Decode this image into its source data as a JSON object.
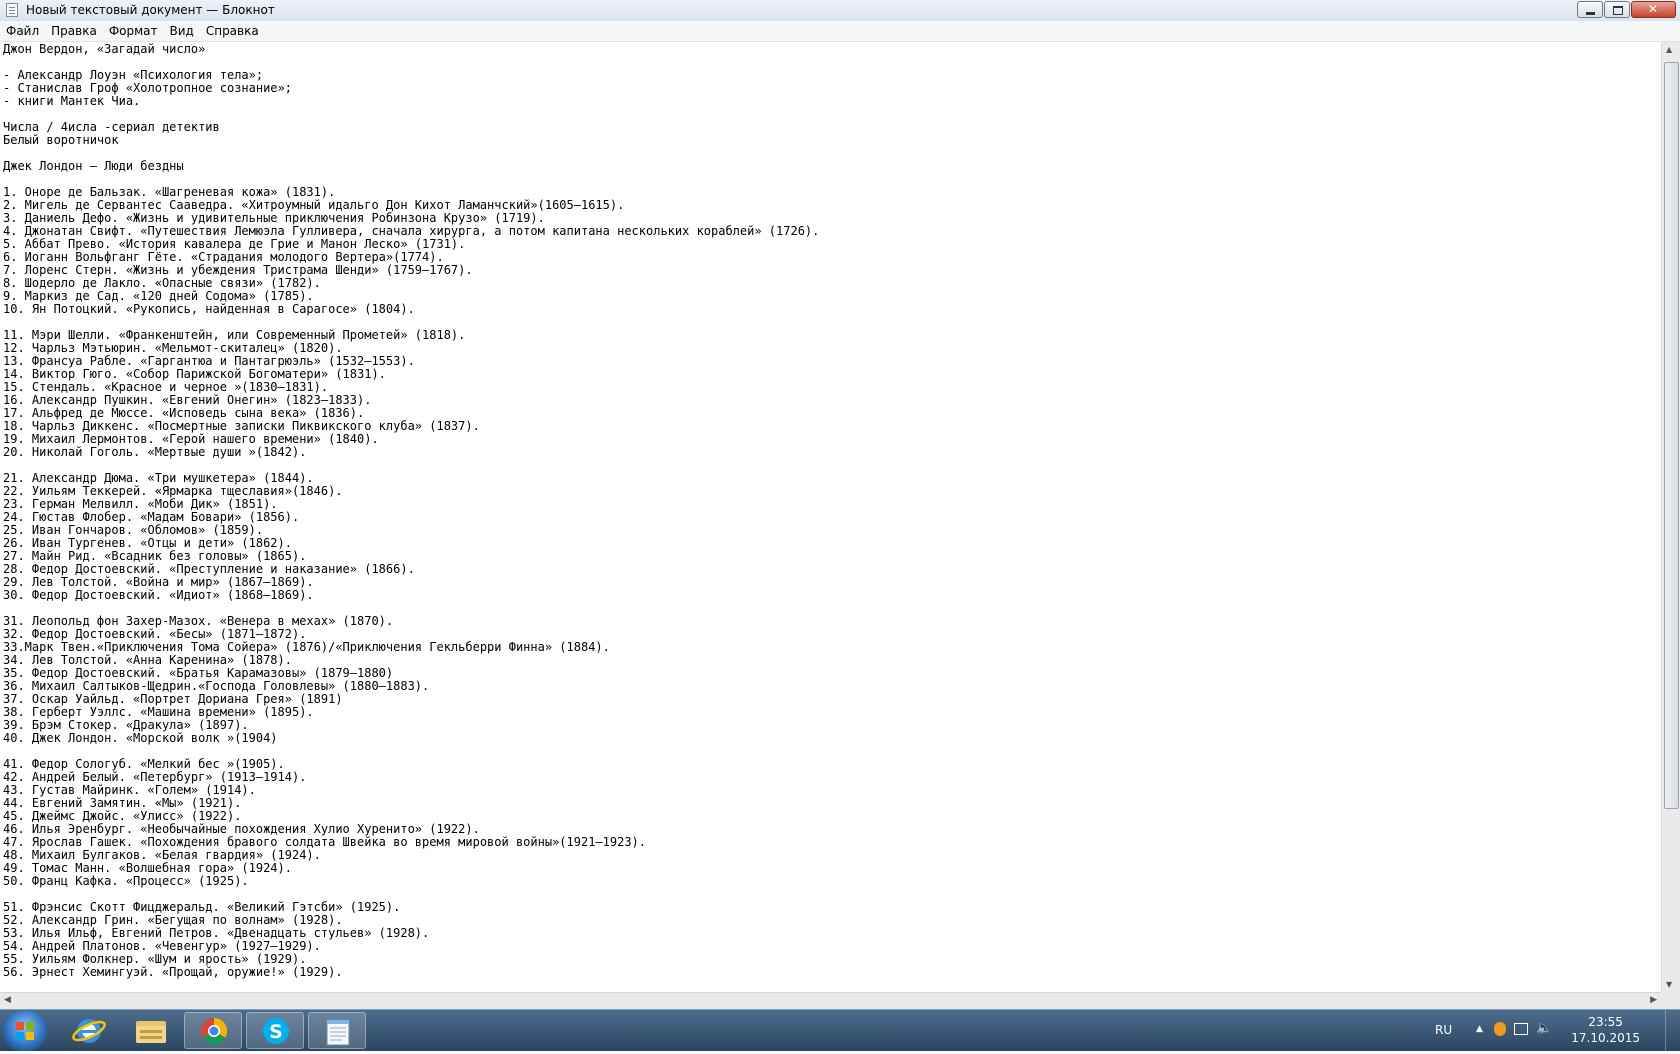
{
  "window": {
    "title": "Новый текстовый документ — Блокнот"
  },
  "menu": [
    "Файл",
    "Правка",
    "Формат",
    "Вид",
    "Справка"
  ],
  "document": {
    "text": "Джон Вердон, «Загадай число»\n\n- Александр Лоуэн «Психология тела»;\n- Станислав Гроф «Холотропное сознание»;\n- книги Мантек Чиа.\n\nЧисла / 4исла -сериал детектив\nБелый воротничок\n\nДжек Лондон – Люди бездны\n\n1. Оноре де Бальзак. «Шагреневая кожа» (1831).\n2. Мигель де Сервантес Сааведра. «Хитроумный идальго Дон Кихот Ламанчский»(1605–1615).\n3. Даниель Дефо. «Жизнь и удивительные приключения Робинзона Крузо» (1719).\n4. Джонатан Свифт. «Путешествия Лемюэла Гулливера, сначала хирурга, а потом капитана нескольких кораблей» (1726).\n5. Аббат Прево. «История кавалера де Грие и Манон Леско» (1731).\n6. Иоганн Вольфганг Гёте. «Страдания молодого Вертера»(1774).\n7. Лоренс Стерн. «Жизнь и убеждения Тристрама Шенди» (1759–1767).\n8. Шодерло де Лакло. «Опасные связи» (1782).\n9. Маркиз де Сад. «120 дней Содома» (1785).\n10. Ян Потоцкий. «Рукопись, найденная в Сарагосе» (1804).\n\n11. Мэри Шелли. «Франкенштейн, или Современный Прометей» (1818).\n12. Чарльз Мэтьюрин. «Мельмот-скиталец» (1820).\n13. Франсуа Рабле. «Гаргантюа и Пантагрюэль» (1532–1553).\n14. Виктор Гюго. «Собор Парижской Богоматери» (1831).\n15. Стендаль. «Красное и черное »(1830–1831).\n16. Александр Пушкин. «Евгений Онегин» (1823–1833).\n17. Альфред де Мюссе. «Исповедь сына века» (1836).\n18. Чарльз Диккенс. «Посмертные записки Пиквикского клуба» (1837).\n19. Михаил Лермонтов. «Герой нашего времени» (1840).\n20. Николай Гоголь. «Мертвые души »(1842).\n\n21. Александр Дюма. «Три мушкетера» (1844).\n22. Уильям Теккерей. «Ярмарка тщеславия»(1846).\n23. Герман Мелвилл. «Моби Дик» (1851).\n24. Гюстав Флобер. «Мадам Бовари» (1856).\n25. Иван Гончаров. «Обломов» (1859).\n26. Иван Тургенев. «Отцы и дети» (1862).\n27. Майн Рид. «Всадник без головы» (1865).\n28. Федор Достоевский. «Преступление и наказание» (1866).\n29. Лев Толстой. «Война и мир» (1867–1869).\n30. Федор Достоевский. «Идиот» (1868–1869).\n\n31. Леопольд фон Захер-Мазох. «Венера в мехах» (1870).\n32. Федор Достоевский. «Бесы» (1871–1872).\n33.Марк Твен.«Приключения Тома Сойера» (1876)/«Приключения Гекльберри Финна» (1884).\n34. Лев Толстой. «Анна Каренина» (1878).\n35. Федор Достоевский. «Братья Карамазовы» (1879–1880)\n36. Михаил Салтыков-Щедрин.«Господа Головлевы» (1880–1883).\n37. Оскар Уайльд. «Портрет Дориана Грея» (1891)\n38. Герберт Уэллс. «Машина времени» (1895).\n39. Брэм Стокер. «Дракула» (1897).\n40. Джек Лондон. «Морской волк »(1904)\n\n41. Федор Сологуб. «Мелкий бес »(1905).\n42. Андрей Белый. «Петербург» (1913–1914).\n43. Густав Майринк. «Голем» (1914).\n44. Евгений Замятин. «Мы» (1921).\n45. Джеймс Джойс. «Улисс» (1922).\n46. Илья Эренбург. «Необычайные похождения Хулио Хуренито» (1922).\n47. Ярослав Гашек. «Похождения бравого солдата Швейка во время мировой войны»(1921–1923).\n48. Михаил Булгаков. «Белая гвардия» (1924).\n49. Томас Манн. «Волшебная гора» (1924).\n50. Франц Кафка. «Процесс» (1925).\n\n51. Фрэнсис Скотт Фицджеральд. «Великий Гэтсби» (1925).\n52. Александр Грин. «Бегущая по волнам» (1928).\n53. Илья Ильф, Евгений Петров. «Двенадцать стульев» (1928).\n54. Андрей Платонов. «Чевенгур» (1927–1929).\n55. Уильям Фолкнер. «Шум и ярость» (1929).\n56. Эрнест Хемингуэй. «Прощай, оружие!» (1929)."
  },
  "taskbar": {
    "apps": [
      "start-button",
      "internet-explorer-icon",
      "file-explorer-icon",
      "chrome-icon",
      "skype-icon",
      "notepad-icon"
    ],
    "active_app": "notepad",
    "tray": {
      "language": "RU",
      "time": "23:55",
      "date": "17.10.2015"
    }
  },
  "colors": {
    "taskbar": "#2b4660",
    "close_button": "#c7432b"
  }
}
